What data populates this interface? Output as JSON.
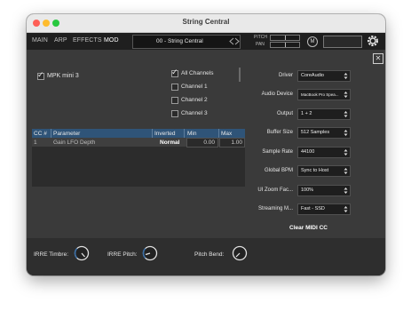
{
  "window": {
    "title": "String Central"
  },
  "topbar": {
    "tabs": [
      {
        "label": "MAIN",
        "active": false
      },
      {
        "label": "ARP",
        "active": false
      },
      {
        "label": "EFFECTS",
        "active": false
      },
      {
        "label": "MOD",
        "active": true
      }
    ],
    "preset": "00 - String Central",
    "pitch_label": "PITCH",
    "pan_label": "PAN",
    "m_label": "M"
  },
  "midi": {
    "device": {
      "label": "MPK mini 3",
      "checked": true
    },
    "channels": [
      {
        "label": "All Channels",
        "checked": true
      },
      {
        "label": "Channel 1",
        "checked": false
      },
      {
        "label": "Channel 2",
        "checked": false
      },
      {
        "label": "Channel 3",
        "checked": false
      }
    ]
  },
  "cc_table": {
    "headers": [
      "CC #",
      "Parameter",
      "Inverted",
      "Min",
      "Max"
    ],
    "rows": [
      {
        "cc": "1",
        "parameter": "Gain LFO Depth",
        "inverted": "Normal",
        "min": "0.00",
        "max": "1.00"
      }
    ]
  },
  "settings": [
    {
      "label": "Driver",
      "value": "CoreAudio"
    },
    {
      "label": "Audio Device",
      "value": "MacBook Pro Spea..."
    },
    {
      "label": "Output",
      "value": "1 + 2"
    },
    {
      "label": "Buffer Size",
      "value": "512 Samples"
    },
    {
      "label": "Sample Rate",
      "value": "44100"
    },
    {
      "label": "Global BPM",
      "value": "Sync to Host"
    },
    {
      "label": "UI Zoom Fac...",
      "value": "100%"
    },
    {
      "label": "Streaming M...",
      "value": "Fast - SSD"
    }
  ],
  "clear_midi_cc": "Clear MIDI CC",
  "controls": {
    "timbre": "IRRE Timbre:",
    "pitch": "IRRE Pitch:",
    "bend": "Pitch Bend:"
  },
  "colors": {
    "panel": "#3a3a3a",
    "header_blue": "#2f5478",
    "knob_ring": "#e0e0e0",
    "knob_accent": "#3a6ea5"
  }
}
